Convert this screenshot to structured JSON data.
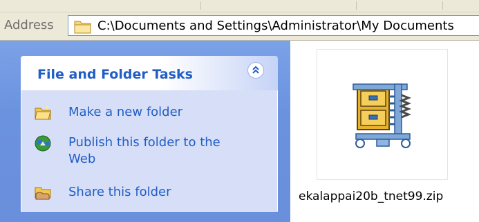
{
  "address": {
    "label": "Address",
    "path": "C:\\Documents and Settings\\Administrator\\My Documents"
  },
  "task_pane": {
    "title": "File and Folder Tasks",
    "items": [
      {
        "label": "Make a new folder",
        "icon": "new-folder-icon"
      },
      {
        "label": "Publish this folder to the Web",
        "icon": "publish-web-icon"
      },
      {
        "label": "Share this folder",
        "icon": "share-folder-icon"
      }
    ]
  },
  "files": [
    {
      "name": "ekalappai20b_tnet99.zip",
      "icon": "zip-archive-icon"
    }
  ],
  "colors": {
    "task_link": "#215dc6",
    "pane_background": "#6b92df",
    "task_body": "#d6dff7"
  }
}
